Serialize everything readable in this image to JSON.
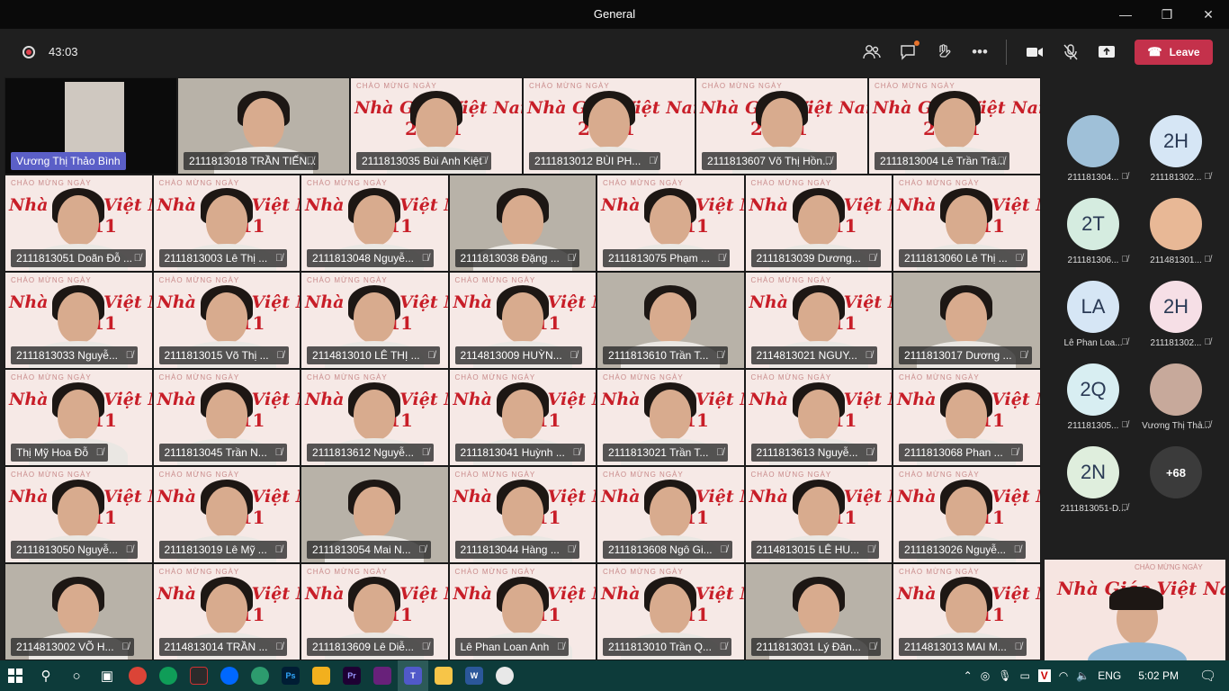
{
  "window": {
    "title": "General",
    "minimize": "—",
    "restore": "❐",
    "close": "✕"
  },
  "toolbar": {
    "timer": "43:03",
    "leave_label": "Leave"
  },
  "host_label": "Vương Thị Thảo Bình",
  "tiles": [
    "2111813018 TRẦN TIẾN...",
    "2111813035 Bùi Anh Kiệt",
    "2111813012 BÙI PH...",
    "2111813607 Võ Thị Hồn...",
    "2111813004 Lê Trần Trâ...",
    "2111813051 Doãn Đỗ ...",
    "2111813003 Lê Thị ...",
    "2111813048 Nguyễ...",
    "2111813038 Đặng ...",
    "2111813075 Phạm ...",
    "2111813039 Dương...",
    "2111813060 Lê Thị ...",
    "2111813033 Nguyễ...",
    "2111813015 Võ Thị ...",
    "2114813010 LÊ THỊ ...",
    "2114813009 HUỲN...",
    "2111813610 Trần T...",
    "2114813021 NGUY...",
    "2111813017 Dương ...",
    "Thị Mỹ Hoa Đỗ",
    "2111813045 Trần N...",
    "2111813612 Nguyễ...",
    "2111813041 Huỳnh ...",
    "2111813021 Trần T...",
    "2111813613 Nguyễ...",
    "2111813068 Phan ...",
    "2111813050 Nguyễ...",
    "2111813019 Lê Mỹ ...",
    "2111813054 Mai N...",
    "2111813044 Hàng ...",
    "2111813608 Ngô Gi...",
    "2114813015 LÊ HU...",
    "2111813026 Nguyễ...",
    "2114813002 VÕ H...",
    "2114813014 TRẦN ...",
    "2111813609 Lê Diễ...",
    "Lê Phan Loan  Anh",
    "2111813010 Trần Q...",
    "2111813031 Lý Đăn...",
    "2114813013 MAI M..."
  ],
  "tile_background": {
    "line1": "CHÀO MỪNG NGÀY",
    "line2": "Nhà Giáo Việt Nam",
    "line3": "20-11"
  },
  "roster": [
    {
      "initials": "",
      "name": "211181304...",
      "color": "#9fc0d8"
    },
    {
      "initials": "2H",
      "name": "211181302...",
      "color": "#d6e6f5"
    },
    {
      "initials": "2T",
      "name": "211181306...",
      "color": "#d5ece0"
    },
    {
      "initials": "",
      "name": "211481301...",
      "color": "#e8b896"
    },
    {
      "initials": "LA",
      "name": "Lê Phan Loa...",
      "color": "#d6e6f5"
    },
    {
      "initials": "2H",
      "name": "211181302...",
      "color": "#f6dfe6"
    },
    {
      "initials": "2Q",
      "name": "211181305...",
      "color": "#d8eef2"
    },
    {
      "initials": "",
      "name": "Vương Thị Thả...",
      "color": "#c7a99b"
    },
    {
      "initials": "2N",
      "name": "2111813051-D...",
      "color": "#dfeedd"
    },
    {
      "initials": "+68",
      "name": "",
      "color": "#3b3b3b"
    }
  ],
  "taskbar": {
    "language": "ENG",
    "time": "5:02 PM"
  }
}
